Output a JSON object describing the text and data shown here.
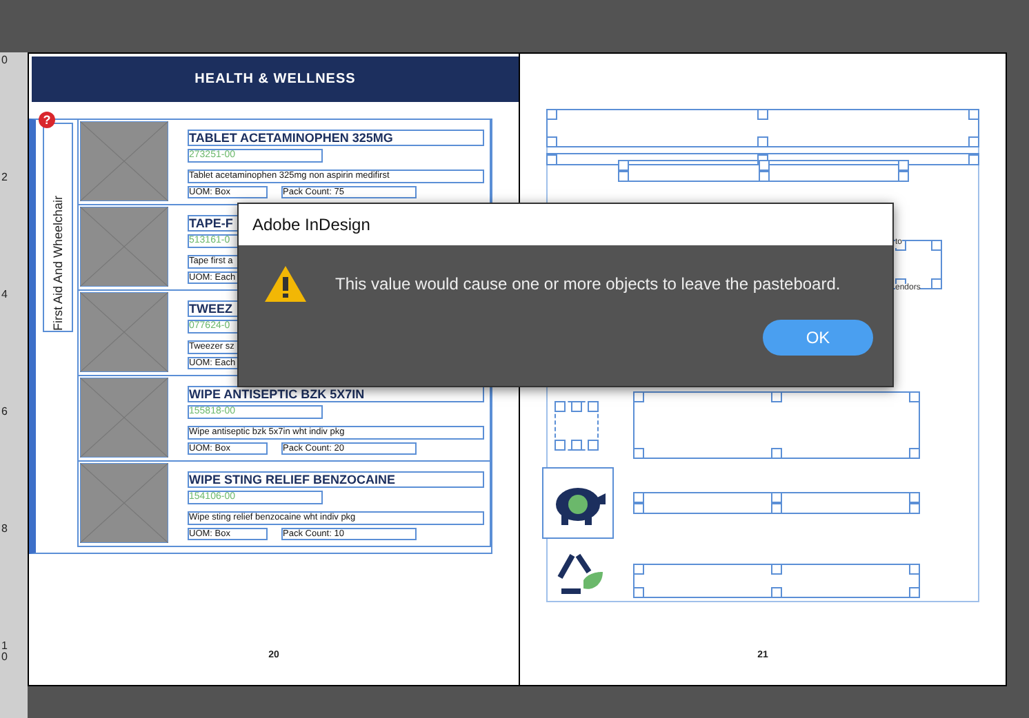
{
  "ruler_labels": [
    "0",
    "2",
    "4",
    "6",
    "8",
    "10"
  ],
  "left_page": {
    "section_header": "HEALTH & WELLNESS",
    "alert_badge": "?",
    "category_tab": "First Aid And Wheelchair",
    "page_number": "20",
    "products": [
      {
        "name": "TABLET ACETAMINOPHEN 325MG",
        "sku": "273251-00",
        "description": "Tablet acetaminophen 325mg non aspirin medifirst",
        "uom": "UOM: Box",
        "pack_count": "Pack Count: 75"
      },
      {
        "name": "TAPE-F",
        "sku": "513161-0",
        "description": "Tape first a",
        "uom": "UOM: Each"
      },
      {
        "name": "TWEEZ",
        "sku": "077624-0",
        "description": "Tweezer sz",
        "uom": "UOM: Each"
      },
      {
        "name": "WIPE ANTISEPTIC BZK 5X7IN",
        "sku": "155818-00",
        "description": "Wipe antiseptic bzk 5x7in wht indiv pkg",
        "uom": "UOM: Box",
        "pack_count": "Pack Count: 20"
      },
      {
        "name": "WIPE STING RELIEF BENZOCAINE",
        "sku": "154106-00",
        "description": "Wipe sting relief benzocaine wht indiv pkg",
        "uom": "UOM: Box",
        "pack_count": "Pack Count: 10"
      }
    ]
  },
  "right_page": {
    "text_fragments": [
      "to",
      "endors"
    ],
    "page_number": "21"
  },
  "dialog": {
    "title": "Adobe InDesign",
    "message": "This value would cause one or more objects to leave the pasteboard.",
    "button": "OK"
  }
}
